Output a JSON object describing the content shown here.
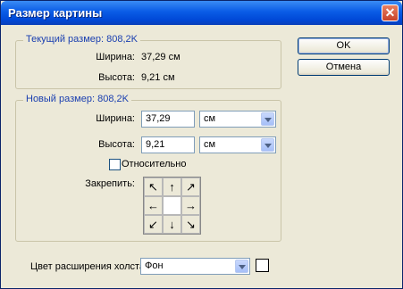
{
  "title": "Размер картины",
  "buttons": {
    "ok": "OK",
    "cancel": "Отмена"
  },
  "current": {
    "legend": "Текущий размер:  808,2K",
    "width_label": "Ширина:",
    "width_value": "37,29 см",
    "height_label": "Высота:",
    "height_value": "9,21 см"
  },
  "new": {
    "legend": "Новый размер:  808,2K",
    "width_label": "Ширина:",
    "width_value": "37,29",
    "width_unit": "см",
    "height_label": "Высота:",
    "height_value": "9,21",
    "height_unit": "см",
    "relative_label": "Относительно",
    "relative_checked": false,
    "anchor_label": "Закрепить:",
    "anchor_arrows": [
      "↖",
      "↑",
      "↗",
      "←",
      "",
      "→",
      "↙",
      "↓",
      "↘"
    ]
  },
  "extension": {
    "label": "Цвет расширения холста:",
    "value": "Фон",
    "swatch_color": "#ffffff"
  }
}
